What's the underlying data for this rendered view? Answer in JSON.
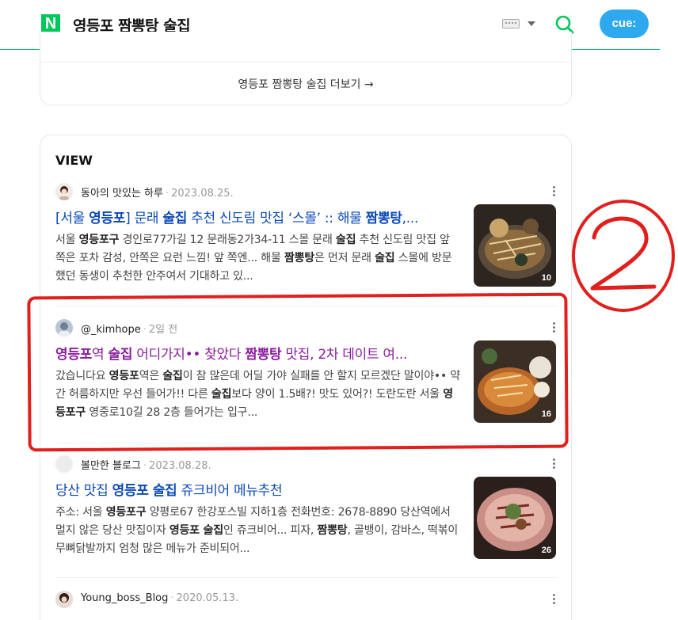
{
  "header": {
    "logo_letter": "N",
    "query": "영등포 짬뽕탕 술집",
    "cue_label": "cue:",
    "accent_color": "#03c75a"
  },
  "more": {
    "label": "영등포 짬뽕탕 술집 더보기 →"
  },
  "view": {
    "title": "VIEW",
    "items": [
      {
        "author": "동아의 맛있는 하루",
        "date": "2023.08.25.",
        "title_parts": [
          "[서울 ",
          "영등포",
          "] 문래 ",
          "술집",
          " 추천 신도림 맛집 ‘스몰’ :: 해물 ",
          "짬뽕탕",
          ",..."
        ],
        "desc_parts": [
          "서울 ",
          "영등포구",
          " 경인로77가길 12 문래동2가34-11 스몰 문래 ",
          "술집",
          " 추천 신도림 맛집 앞 쪽은 포차 감성, 안쪽은 요런 느낌! 앞 쪽엔... 해물 ",
          "짬뽕탕",
          "은 먼저 문래 ",
          "술집",
          " 스몰에 방문했던 동생이 추천한 안주여서 기대하고 있..."
        ],
        "image_count": "10",
        "visited": false
      },
      {
        "author": "@_kimhope",
        "date": "2일 전",
        "title_parts": [
          "영등포",
          "역 ",
          "술집",
          " 어디가지•• 찾았다 ",
          "짬뽕탕",
          " 맛집, 2차 데이트 여..."
        ],
        "desc_parts": [
          "갔습니다요 ",
          "영등포",
          "역은 ",
          "술집",
          "이 참 많은데 어딜 가야 실패를 안 할지 모르겠단 말이야•• 약간 허름하지만 우선 들어가!! 다른 ",
          "술집",
          "보다 양이 1.5배?! 맛도 있어?! 도란도란 서울 ",
          "영등포구",
          " 영중로10길 28 2층 들어가는 입구..."
        ],
        "image_count": "16",
        "visited": true
      },
      {
        "author": "볼만한 블로그",
        "date": "2023.08.28.",
        "title_parts": [
          "당산 맛집 ",
          "영등포",
          " ",
          "술집",
          " 쥬크비어 메뉴추천"
        ],
        "desc_parts": [
          "주소: 서울 ",
          "영등포구",
          " 양평로67 한강포스빌 지하1층 전화번호: 2678-8890 당산역에서 멀지 않은 당산 맛집이자 ",
          "영등포 술집",
          "인 쥬크비어... 피자, ",
          "짬뽕탕",
          ", 골뱅이, 감바스, 떡볶이 무뼈닭발까지 엄청 많은 메뉴가 준비되어..."
        ],
        "image_count": "26",
        "visited": false
      },
      {
        "author": "Young_boss_Blog",
        "date": "2020.05.13."
      }
    ]
  },
  "annotation": {
    "label": "2",
    "color": "#e0201c"
  }
}
